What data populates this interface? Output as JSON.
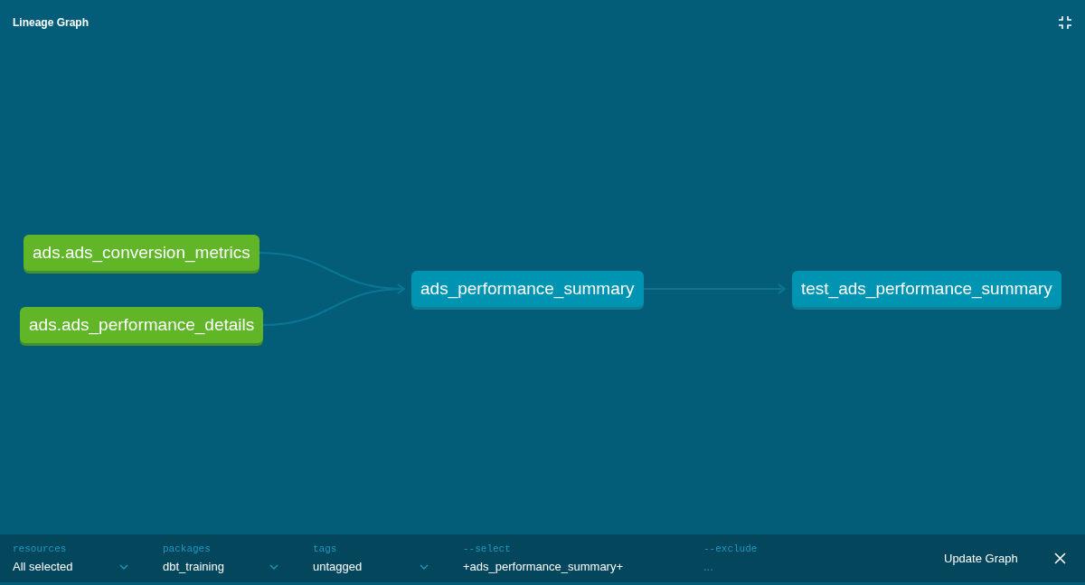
{
  "header": {
    "title": "Lineage Graph"
  },
  "graph": {
    "nodes": [
      {
        "label": "ads.ads_conversion_metrics",
        "kind": "source"
      },
      {
        "label": "ads.ads_performance_details",
        "kind": "source"
      },
      {
        "label": "ads_performance_summary",
        "kind": "model"
      },
      {
        "label": "test_ads_performance_summary",
        "kind": "model"
      }
    ]
  },
  "filters": [
    {
      "label": "resources",
      "kind": "dropdown",
      "value": "All selected"
    },
    {
      "label": "packages",
      "kind": "dropdown",
      "value": "dbt_training"
    },
    {
      "label": "tags",
      "kind": "dropdown",
      "value": "untagged"
    },
    {
      "label": "--select",
      "kind": "text",
      "value": "+ads_performance_summary+"
    },
    {
      "label": "--exclude",
      "kind": "text",
      "placeholder": "..."
    }
  ],
  "update_button": "Update Graph"
}
